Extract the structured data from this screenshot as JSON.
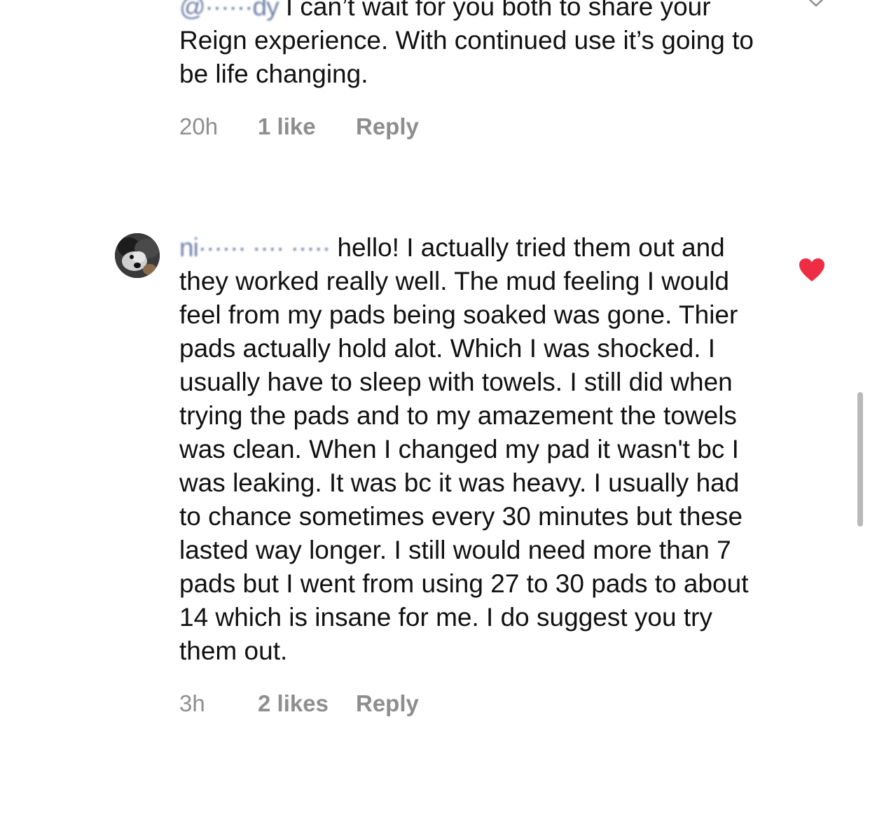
{
  "comments": [
    {
      "username": "@······dy",
      "text": " I can’t wait for you both to share your Reign experience. With continued use it’s going to be life changing.",
      "time": "20h",
      "likes": "1 like",
      "reply_label": "Reply",
      "liked": false
    },
    {
      "username": "ni······ ···· ·····",
      "text": " hello! I actually tried them out and they worked really well. The mud feeling I would feel from my pads being soaked was gone. Thier pads actually hold alot. Which I was shocked. I usually have to sleep with towels. I still did when trying the pads and to my amazement the towels was clean. When I changed my pad it wasn't bc I was leaking. It was bc it was heavy. I usually had to chance sometimes every 30 minutes but these lasted way longer. I still would need more than 7 pads but I went from using 27 to 30 pads to about 14 which is insane for me. I do suggest you try them out.",
      "time": "3h",
      "likes": "2 likes",
      "reply_label": "Reply",
      "liked": true
    }
  ],
  "colors": {
    "heart": "#ee2d45",
    "meta_text": "#8e8e8e"
  }
}
